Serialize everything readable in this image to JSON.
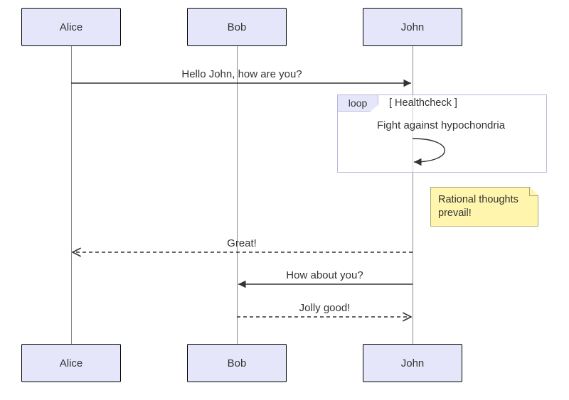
{
  "chart_data": {
    "type": "sequence-diagram",
    "actors": [
      "Alice",
      "Bob",
      "John"
    ],
    "messages": [
      {
        "from": "Alice",
        "to": "John",
        "text": "Hello John, how are you?",
        "style": "solid"
      },
      {
        "loop": {
          "label": "loop",
          "condition": "[ Healthcheck ]",
          "body": [
            {
              "from": "John",
              "to": "John",
              "text": "Fight against hypochondria",
              "style": "solid-self"
            }
          ]
        }
      },
      {
        "note": {
          "attachedTo": "John",
          "side": "right",
          "text": "Rational thoughts prevail!"
        }
      },
      {
        "from": "John",
        "to": "Alice",
        "text": "Great!",
        "style": "dashed"
      },
      {
        "from": "John",
        "to": "Bob",
        "text": "How about you?",
        "style": "solid"
      },
      {
        "from": "Bob",
        "to": "John",
        "text": "Jolly good!",
        "style": "dashed"
      }
    ]
  },
  "actors": {
    "a": "Alice",
    "b": "Bob",
    "c": "John"
  },
  "messages": {
    "m1": "Hello John, how are you?",
    "loop_label": "loop",
    "loop_cond": "[ Healthcheck ]",
    "loop_msg": "Fight against hypochondria",
    "note_l1": "Rational thoughts",
    "note_l2": "prevail!",
    "m2": "Great!",
    "m3": "How about you?",
    "m4": "Jolly good!"
  }
}
